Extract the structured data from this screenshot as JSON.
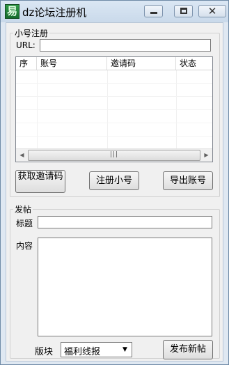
{
  "window": {
    "title": "dz论坛注册机",
    "icon": "app-logo-icon",
    "controls": {
      "minimize": "minimize-icon",
      "maximize": "maximize-icon",
      "close": "close-icon"
    }
  },
  "register_group": {
    "legend": "小号注册",
    "url_label": "URL:",
    "url_value": "",
    "table": {
      "columns": [
        "序",
        "账号",
        "邀请码",
        "状态"
      ],
      "rows": []
    },
    "buttons": {
      "get_invite_code": "获取邀请码",
      "register": "注册小号",
      "export": "导出账号"
    }
  },
  "post_group": {
    "legend": "发帖",
    "title_label": "标题",
    "title_value": "",
    "content_label": "内容",
    "content_value": "",
    "board_label": "版块",
    "board_selected": "福利线报",
    "publish_button": "发布新帖"
  }
}
